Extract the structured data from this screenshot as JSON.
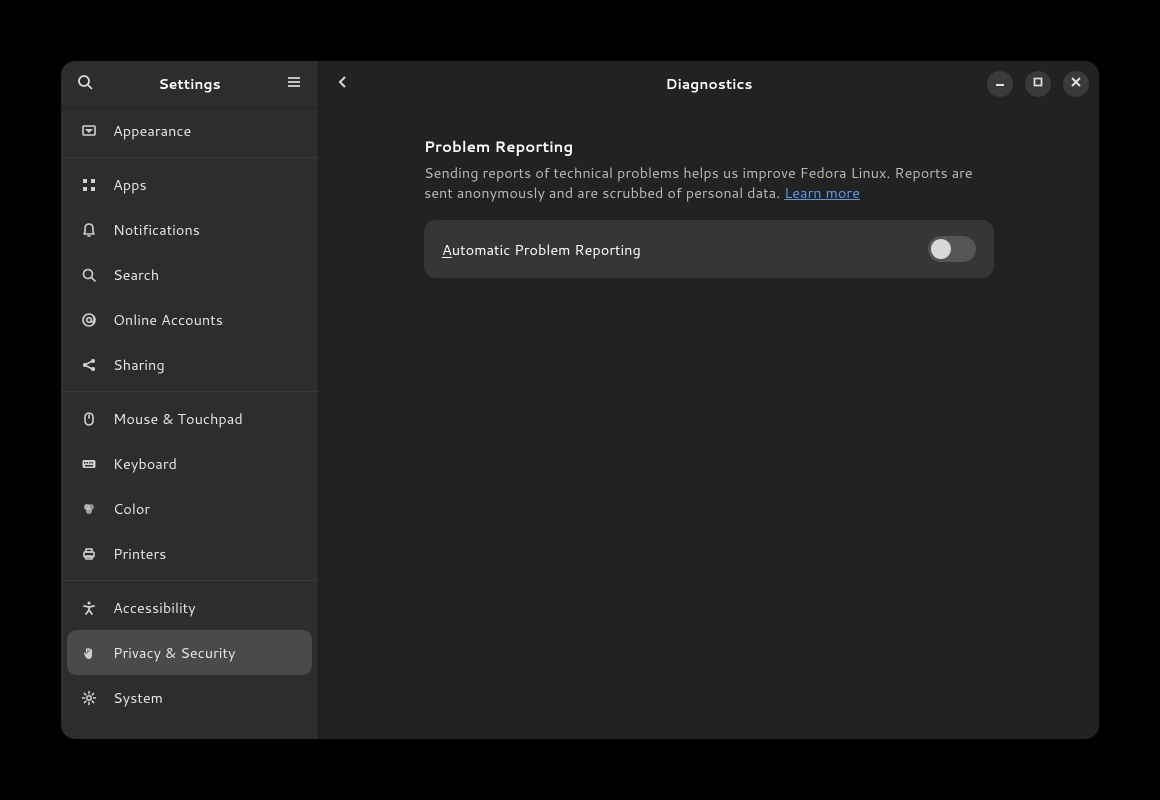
{
  "sidebar": {
    "title": "Settings",
    "groups": [
      [
        {
          "id": "appearance",
          "label": "Appearance",
          "icon": "appearance"
        }
      ],
      [
        {
          "id": "apps",
          "label": "Apps",
          "icon": "apps"
        },
        {
          "id": "notifications",
          "label": "Notifications",
          "icon": "bell"
        },
        {
          "id": "search",
          "label": "Search",
          "icon": "search"
        },
        {
          "id": "online-accounts",
          "label": "Online Accounts",
          "icon": "at"
        },
        {
          "id": "sharing",
          "label": "Sharing",
          "icon": "share"
        }
      ],
      [
        {
          "id": "mouse-touchpad",
          "label": "Mouse & Touchpad",
          "icon": "mouse"
        },
        {
          "id": "keyboard",
          "label": "Keyboard",
          "icon": "keyboard"
        },
        {
          "id": "color",
          "label": "Color",
          "icon": "color"
        },
        {
          "id": "printers",
          "label": "Printers",
          "icon": "printer"
        }
      ],
      [
        {
          "id": "accessibility",
          "label": "Accessibility",
          "icon": "accessibility"
        },
        {
          "id": "privacy-security",
          "label": "Privacy & Security",
          "icon": "hand",
          "selected": true
        },
        {
          "id": "system",
          "label": "System",
          "icon": "gear"
        }
      ]
    ]
  },
  "header": {
    "title": "Diagnostics"
  },
  "content": {
    "section_title": "Problem Reporting",
    "section_desc": "Sending reports of technical problems helps us improve Fedora Linux. Reports are sent anonymously and are scrubbed of personal data. ",
    "learn_more": "Learn more",
    "row_label_prefix": "A",
    "row_label_rest": "utomatic Problem Reporting",
    "switch_state": false
  }
}
